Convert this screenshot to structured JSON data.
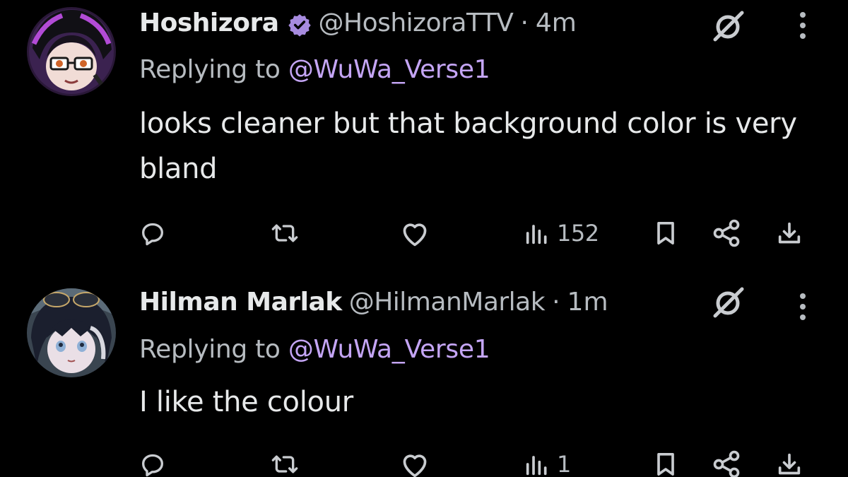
{
  "colors": {
    "background": "#000000",
    "primary_text": "#e7e9ea",
    "secondary_text": "#b7bcc1",
    "mention": "#c4a5f5",
    "verified_badge": "#a78bdf"
  },
  "tweets": [
    {
      "author_name": "Hoshizora",
      "verified": true,
      "handle": "@HoshizoraTTV",
      "separator": "·",
      "time": "4m",
      "replying_prefix": "Replying to",
      "replying_to": "@WuWa_Verse1",
      "text": "looks cleaner but that background color is very bland",
      "views": "152",
      "avatar_icon": "anime-avatar-purple-hair"
    },
    {
      "author_name": "Hilman Marlak",
      "verified": false,
      "handle": "@HilmanMarlak",
      "separator": "·",
      "time": "1m",
      "replying_prefix": "Replying to",
      "replying_to": "@WuWa_Verse1",
      "text": "I like the colour",
      "views": "1",
      "avatar_icon": "anime-avatar-dark-hair"
    }
  ],
  "icons": {
    "reply": "reply-icon",
    "retweet": "retweet-icon",
    "like": "heart-icon",
    "views": "views-icon",
    "bookmark": "bookmark-icon",
    "share": "share-icon",
    "download": "download-icon",
    "grok": "grok-icon",
    "more": "more-vertical-icon",
    "verified": "verified-badge-icon"
  }
}
